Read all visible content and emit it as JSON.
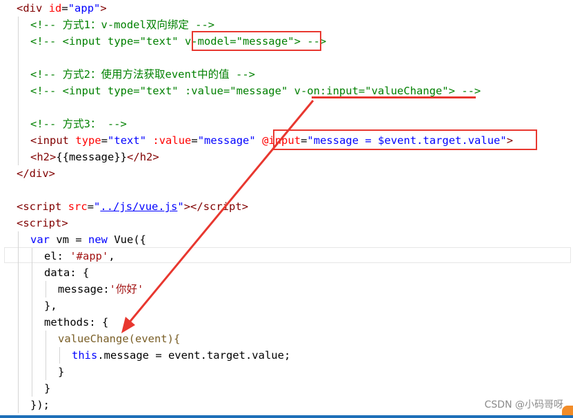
{
  "code": {
    "line1": {
      "open": "<",
      "tag": "div",
      "attr": "id",
      "eq": "=",
      "val": "\"app\"",
      "close": ">"
    },
    "line2": "<!-- 方式1：v-model双向绑定 -->",
    "line3": {
      "a": "<!-- <input type=\"text\" ",
      "b": "v-model=\"message\"",
      "c": "> -->"
    },
    "line5": "<!-- 方式2：使用方法获取event中的值 -->",
    "line6": {
      "a": "<!-- <input type=\"text\" :value=\"message\" ",
      "b": "v-on:input=\"valueChange\"",
      "c": "> -->"
    },
    "line8": "<!-- 方式3： -->",
    "line9": {
      "p1": "<",
      "tag": "input",
      "sp1": " ",
      "attr1": "type",
      "eq1": "=",
      "val1": "\"text\"",
      "sp2": " ",
      "attr2": ":value",
      "eq2": "=",
      "val2": "\"message\"",
      "sp3": " ",
      "attr3": "@input",
      "eq3": "=",
      "val3": "\"message = $event.target.value\"",
      "p2": ">"
    },
    "line10": {
      "open": "<",
      "tag": "h2",
      "close1": ">",
      "text": "{{message}}",
      "open2": "</",
      "tag2": "h2",
      "close2": ">"
    },
    "line11": {
      "open": "</",
      "tag": "div",
      "close": ">"
    },
    "line13": {
      "open": "<",
      "tag": "script",
      "sp": " ",
      "attr": "src",
      "eq": "=",
      "q1": "\"",
      "link": "../js/vue.js",
      "q2": "\"",
      "close": ">",
      "open2": "</",
      "tag2": "script",
      "close2": ">"
    },
    "line14": {
      "open": "<",
      "tag": "script",
      "close": ">"
    },
    "line15": {
      "kw1": "var",
      "mid": " vm = ",
      "kw2": "new",
      "tail": " Vue({"
    },
    "line16": {
      "a": "el: ",
      "b": "'#app'",
      "c": ","
    },
    "line17": "data: {",
    "line18": {
      "a": "message:",
      "b": "'你好'"
    },
    "line19": "},",
    "line20": "methods: {",
    "line21": "valueChange(event){",
    "line22": {
      "kw": "this",
      "rest": ".message = event.target.value;"
    },
    "line23": "}",
    "line24": "}",
    "line25": "});"
  },
  "watermark": "CSDN @小码哥呀",
  "colors": {
    "annotation": "#e8372f",
    "tag": "#800000",
    "attribute": "#ff0000",
    "value": "#0000ff",
    "comment": "#008000"
  }
}
